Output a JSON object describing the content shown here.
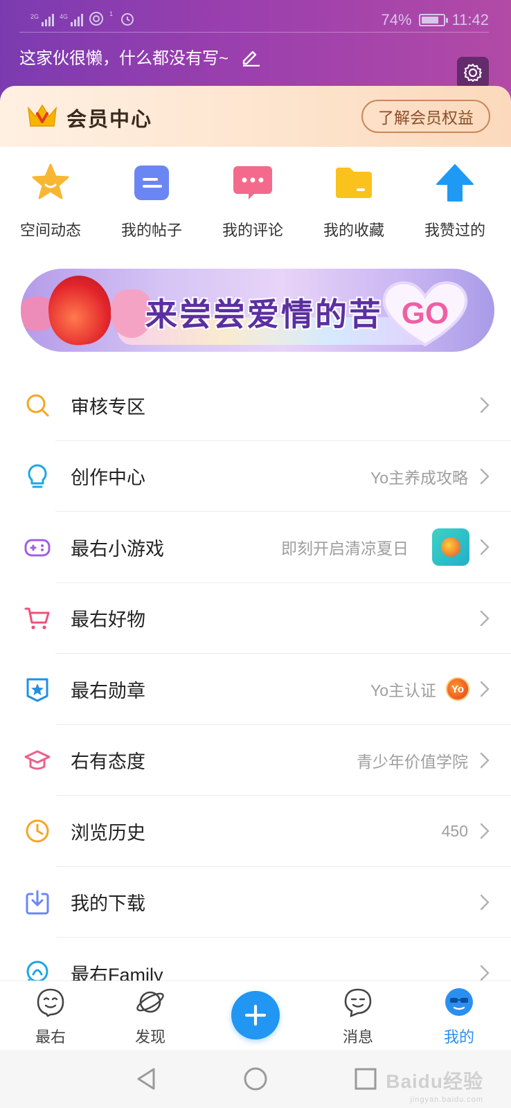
{
  "status_bar": {
    "network_1": "2G",
    "network_2": "4G",
    "sim_index": "1",
    "battery": "74%",
    "time": "11:42"
  },
  "profile": {
    "bio": "这家伙很懒，什么都没有写~"
  },
  "vip": {
    "title": "会员中心",
    "button": "了解会员权益"
  },
  "quick_actions": [
    {
      "label": "空间动态",
      "icon": "star-icon",
      "color": "#f7b733"
    },
    {
      "label": "我的帖子",
      "icon": "post-icon",
      "color": "#6a86f5"
    },
    {
      "label": "我的评论",
      "icon": "comment-icon",
      "color": "#f46a8c"
    },
    {
      "label": "我的收藏",
      "icon": "folder-icon",
      "color": "#f9c21c"
    },
    {
      "label": "我赞过的",
      "icon": "arrow-up-icon",
      "color": "#1e9af5"
    }
  ],
  "banner": {
    "text": "来尝尝爱情的苦",
    "cta": "GO"
  },
  "menu": [
    {
      "title": "审核专区",
      "hint": "",
      "icon": "search-icon",
      "color": "#f5a623"
    },
    {
      "title": "创作中心",
      "hint": "Yo主养成攻略",
      "icon": "lightbulb-icon",
      "color": "#1aa7e8"
    },
    {
      "title": "最右小游戏",
      "hint": "即刻开启清凉夏日",
      "icon": "gamepad-icon",
      "color": "#9c5fe8"
    },
    {
      "title": "最右好物",
      "hint": "",
      "icon": "cart-icon",
      "color": "#f0507a"
    },
    {
      "title": "最右勋章",
      "hint": "Yo主认证",
      "badge": "Yo",
      "icon": "badge-icon",
      "color": "#1e90e8"
    },
    {
      "title": "右有态度",
      "hint": "青少年价值学院",
      "icon": "graduation-cap-icon",
      "color": "#ee5f8a"
    },
    {
      "title": "浏览历史",
      "hint": "450",
      "icon": "clock-icon",
      "color": "#f5a623"
    },
    {
      "title": "我的下载",
      "hint": "",
      "icon": "download-icon",
      "color": "#6a86f5"
    },
    {
      "title": "最右Family",
      "hint": "",
      "icon": "family-icon",
      "color": "#1aa7e8"
    }
  ],
  "tabs": [
    {
      "label": "最右",
      "icon": "smiley-face-icon",
      "active": false
    },
    {
      "label": "发现",
      "icon": "planet-icon",
      "active": false
    },
    {
      "label": "消息",
      "icon": "chat-face-icon",
      "active": false
    },
    {
      "label": "我的",
      "icon": "avatar-face-icon",
      "active": true
    }
  ],
  "colors": {
    "accent": "#2196f3",
    "header_start": "#7b3bb0",
    "header_end": "#b24aa6",
    "vip_text": "#8a4f2a"
  },
  "watermark": {
    "brand": "Baidu经验",
    "url": "jingyan.baidu.com"
  }
}
